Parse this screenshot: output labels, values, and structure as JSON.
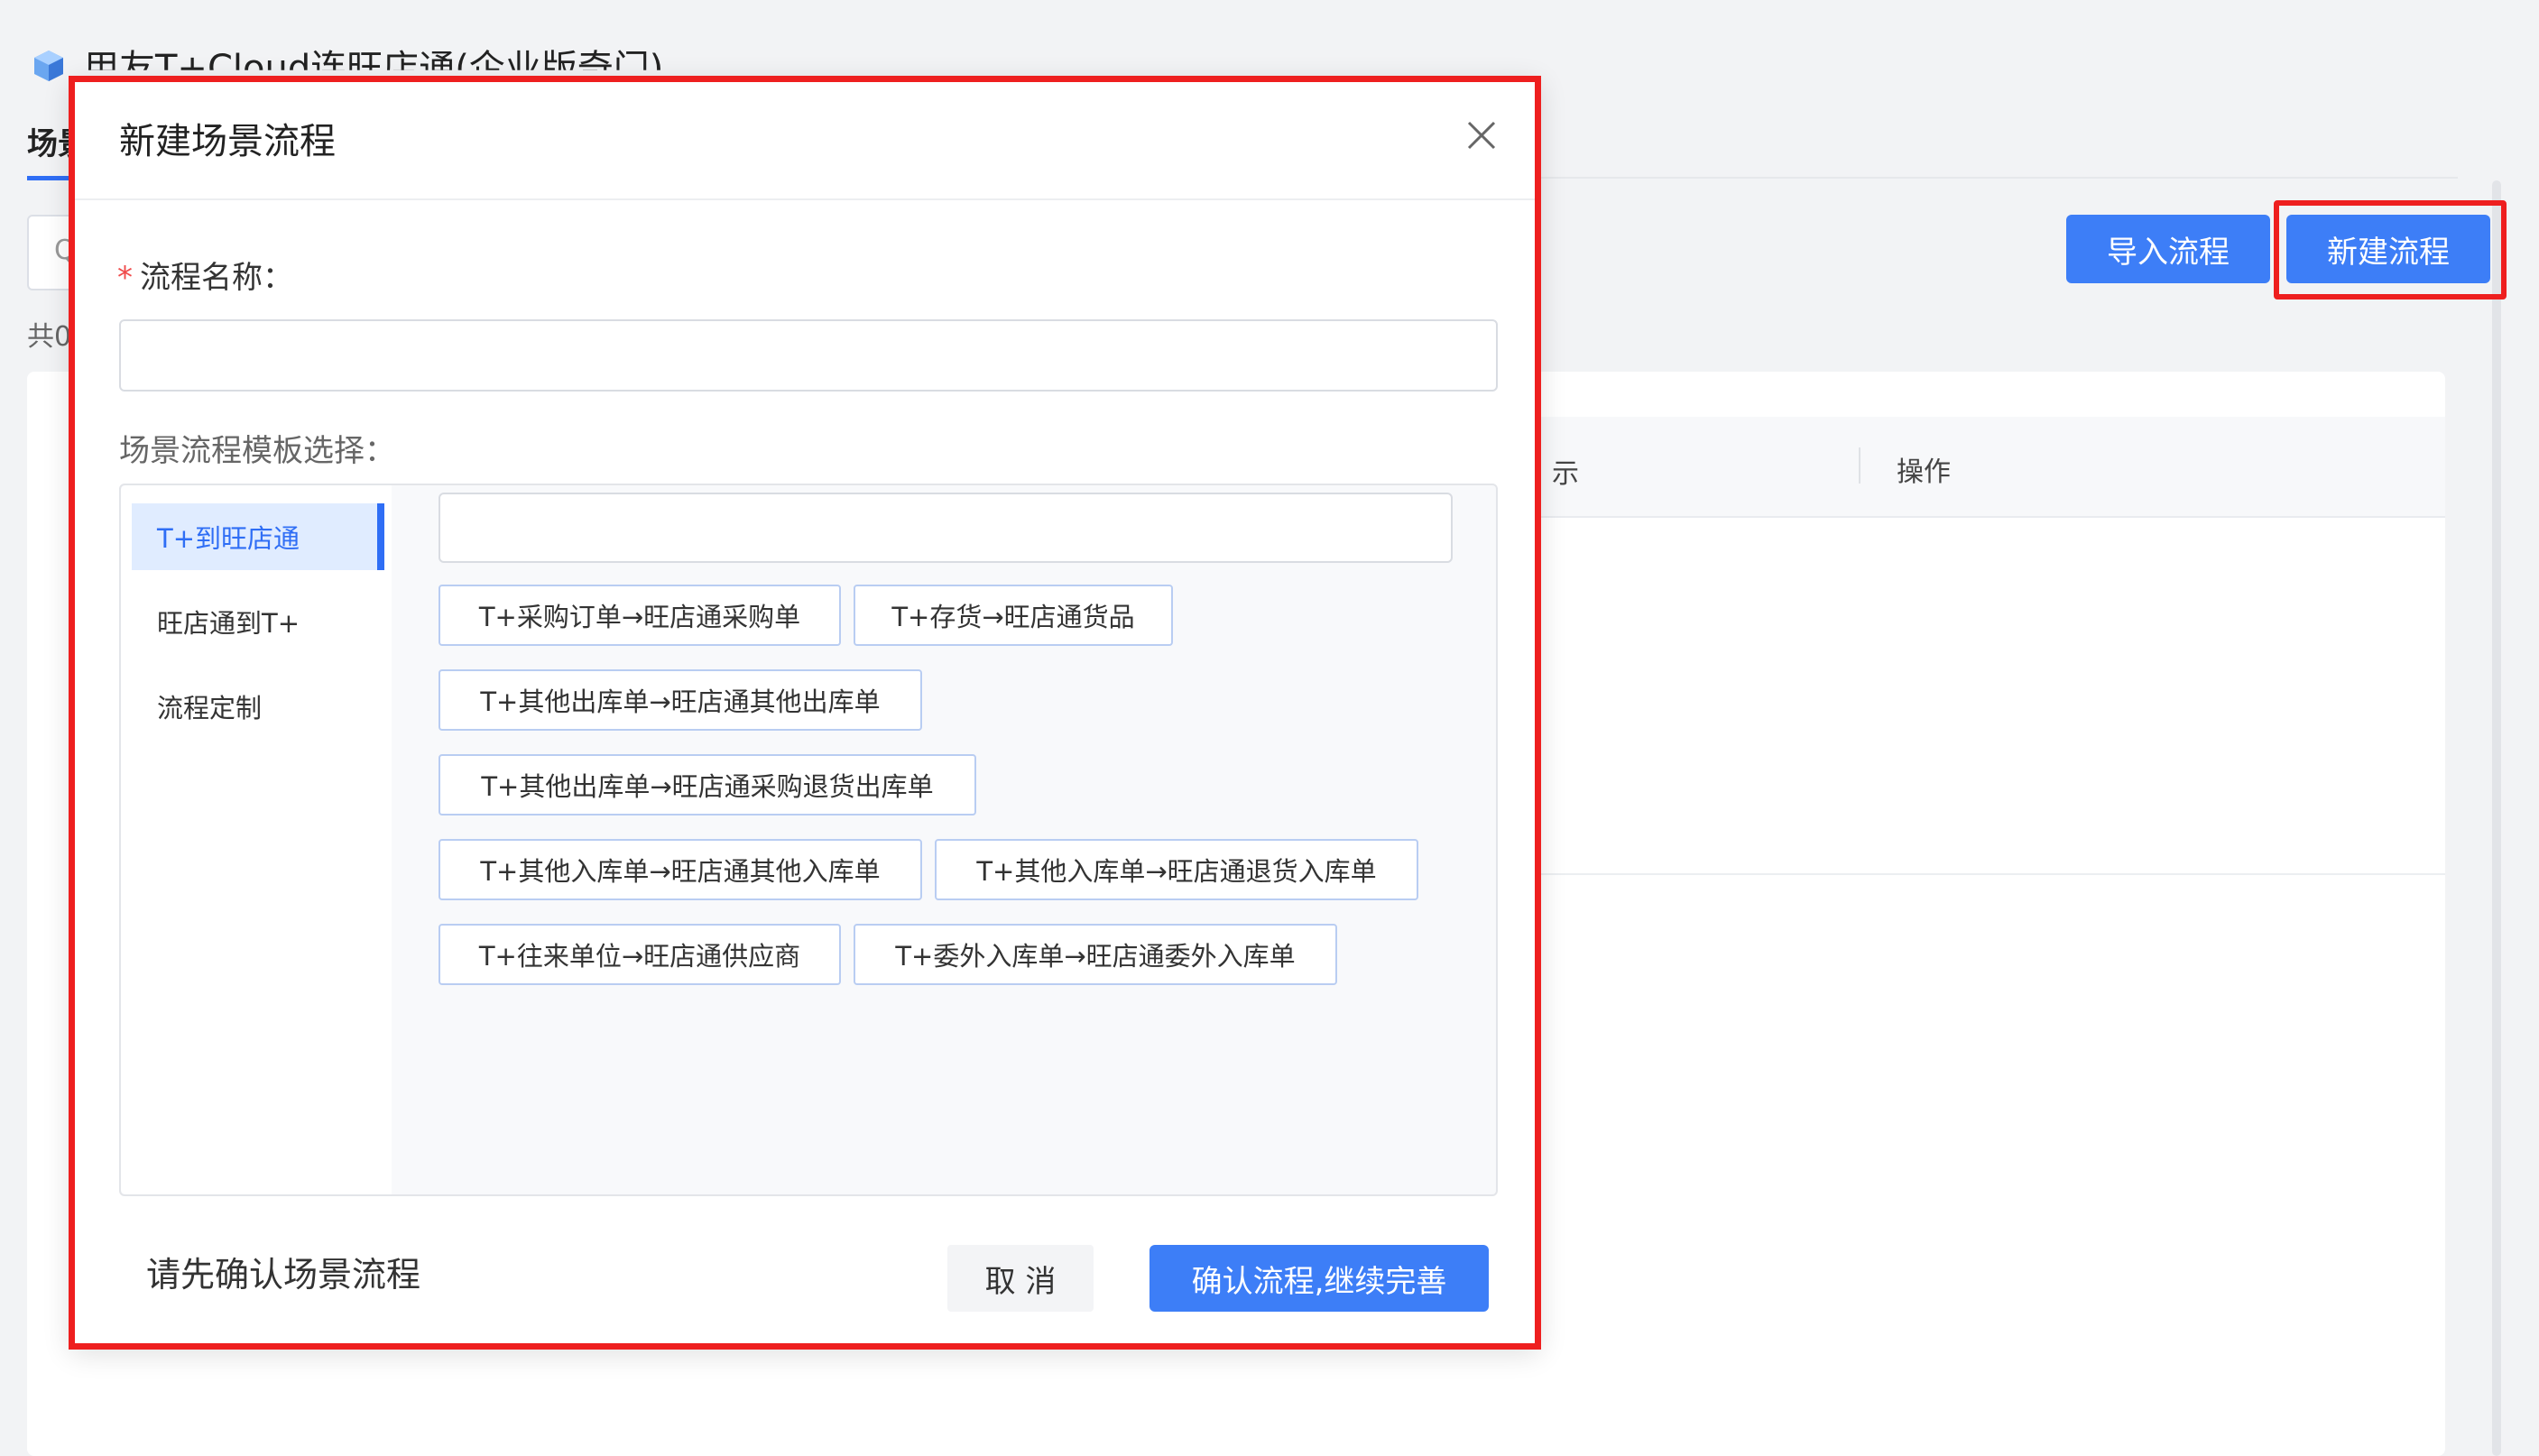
{
  "app": {
    "title": "用友T+Cloud连旺店通(企业版奇门)",
    "tab_active": "场景",
    "count_text": "共0",
    "search_glyph": "Q"
  },
  "toolbar": {
    "import_label": "导入流程",
    "new_label": "新建流程"
  },
  "table": {
    "partial_header": "示",
    "ops_header": "操作"
  },
  "modal": {
    "title": "新建场景流程",
    "name_label": "流程名称：",
    "required_mark": "*",
    "name_value": "",
    "template_label": "场景流程模板选择：",
    "categories": [
      {
        "label": "T+到旺店通",
        "active": true
      },
      {
        "label": "旺店通到T+",
        "active": false
      },
      {
        "label": "流程定制",
        "active": false
      }
    ],
    "template_search_value": "",
    "templates": [
      "T+采购订单→旺店通采购单",
      "T+存货→旺店通货品",
      "T+其他出库单→旺店通其他出库单",
      "T+其他出库单→旺店通采购退货出库单",
      "T+其他入库单→旺店通其他入库单",
      "T+其他入库单→旺店通退货入库单",
      "T+往来单位→旺店通供应商",
      "T+委外入库单→旺店通委外入库单"
    ],
    "footer_hint": "请先确认场景流程",
    "cancel_label": "取 消",
    "confirm_label": "确认流程,继续完善"
  },
  "colors": {
    "primary": "#3d7ef7",
    "highlight": "#ee1f1f",
    "active_bg": "#e0ecff"
  }
}
